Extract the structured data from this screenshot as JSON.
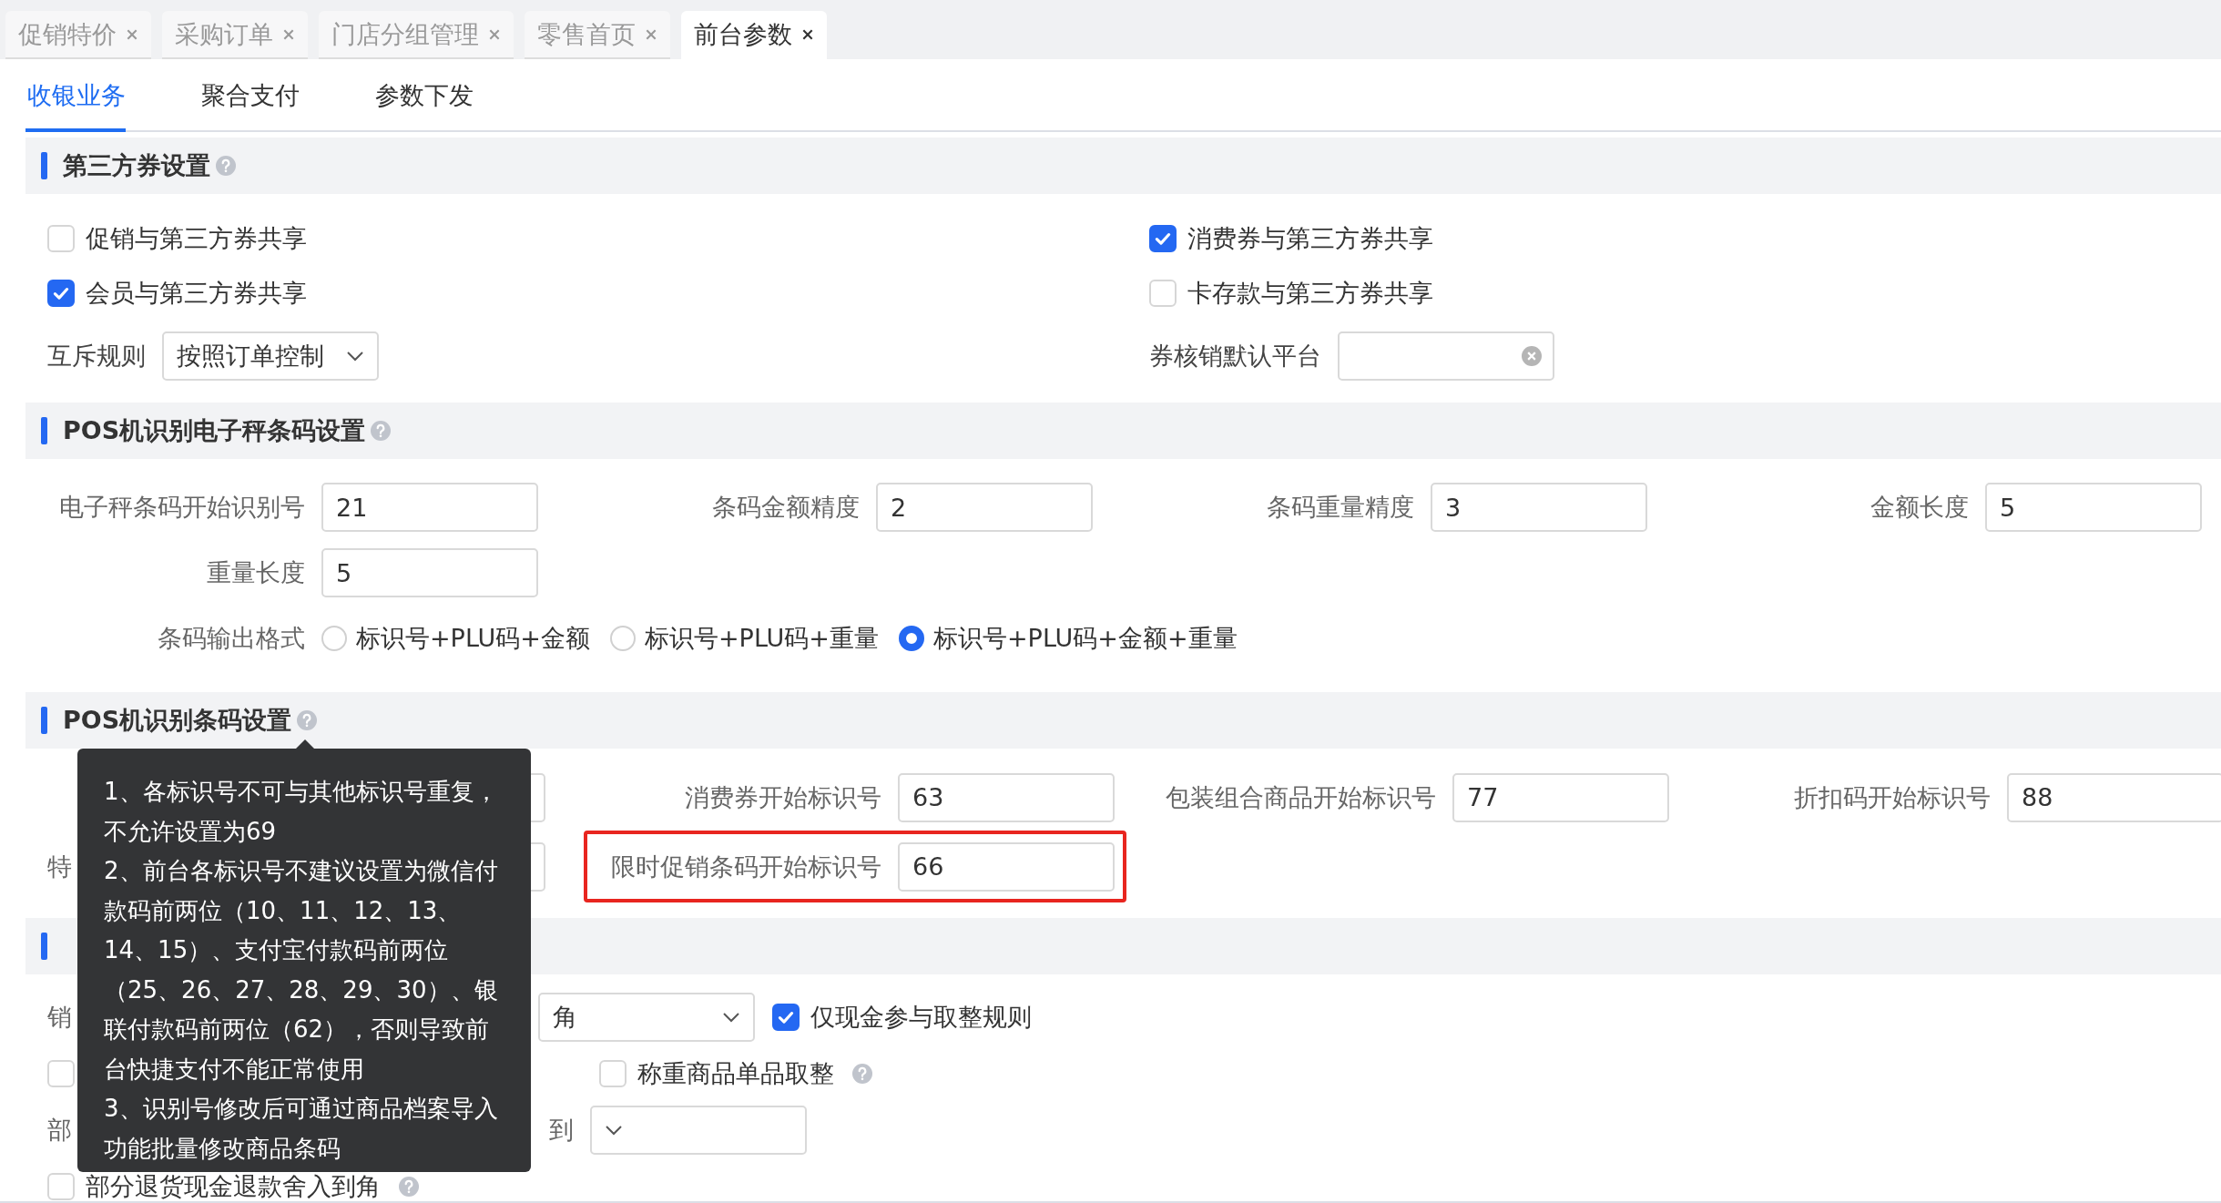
{
  "tabs": [
    {
      "label": "促销特价",
      "selected": false
    },
    {
      "label": "采购订单",
      "selected": false
    },
    {
      "label": "门店分组管理",
      "selected": false
    },
    {
      "label": "零售首页",
      "selected": false
    },
    {
      "label": "前台参数",
      "selected": true
    }
  ],
  "subtabs": [
    {
      "label": "收银业务",
      "selected": true
    },
    {
      "label": "聚合支付",
      "selected": false
    },
    {
      "label": "参数下发",
      "selected": false
    }
  ],
  "third_party": {
    "title": "第三方券设置",
    "options": [
      {
        "label": "促销与第三方券共享",
        "checked": false
      },
      {
        "label": "消费券与第三方券共享",
        "checked": true
      },
      {
        "label": "会员与第三方券共享",
        "checked": true
      },
      {
        "label": "卡存款与第三方券共享",
        "checked": false
      }
    ],
    "exclusion_rule": {
      "label": "互斥规则",
      "value": "按照订单控制"
    },
    "default_platform": {
      "label": "券核销默认平台"
    }
  },
  "scale_barcode": {
    "title": "POS机识别电子秤条码设置",
    "fields": [
      {
        "label": "电子秤条码开始识别号",
        "value": "21"
      },
      {
        "label": "条码金额精度",
        "value": "2"
      },
      {
        "label": "条码重量精度",
        "value": "3"
      },
      {
        "label": "金额长度",
        "value": "5"
      },
      {
        "label": "重量长度",
        "value": "5"
      }
    ],
    "output_format": {
      "label": "条码输出格式",
      "options": [
        {
          "label": "标识号+PLU码+金额",
          "selected": false
        },
        {
          "label": "标识号+PLU码+重量",
          "selected": false
        },
        {
          "label": "标识号+PLU码+金额+重量",
          "selected": true
        }
      ]
    }
  },
  "barcode": {
    "title": "POS机识别条码设置",
    "rows": [
      [
        {
          "kind": "covered"
        },
        {
          "kind": "field",
          "label": "消费券开始标识号",
          "value": "63"
        },
        {
          "kind": "field",
          "label": "包装组合商品开始标识号",
          "value": "77"
        },
        {
          "kind": "field",
          "label": "折扣码开始标识号",
          "value": "88"
        }
      ],
      [
        {
          "kind": "covered",
          "label": "特"
        },
        {
          "kind": "field",
          "label": "限时促销条码开始标识号",
          "value": "66",
          "highlighted": true
        }
      ]
    ]
  },
  "settlement": {
    "rows": [
      {
        "kind": "rounding",
        "label": "销",
        "precision": "角",
        "option": {
          "label": "仅现金参与取整规则",
          "checked": true
        }
      },
      {
        "kind": "checks",
        "first": {
          "checked": false
        },
        "option": {
          "label": "称重商品单品取整",
          "checked": false
        }
      },
      {
        "kind": "refund_rounding",
        "label": "部",
        "precision_label": "到"
      },
      {
        "kind": "check",
        "option": {
          "label": "部分退货现金退款舍入到角",
          "checked": false
        }
      }
    ]
  },
  "tooltip": {
    "paragraphs": [
      "1、各标识号不可与其他标识号重复，不允许设置为69",
      "2、前台各标识号不建议设置为微信付款码前两位（10、11、12、13、14、15）、支付宝付款码前两位（25、26、27、28、29、30）、银联付款码前两位（62），否则导致前台快捷支付不能正常使用",
      "3、识别号修改后可通过商品档案导入功能批量修改商品条码"
    ]
  }
}
